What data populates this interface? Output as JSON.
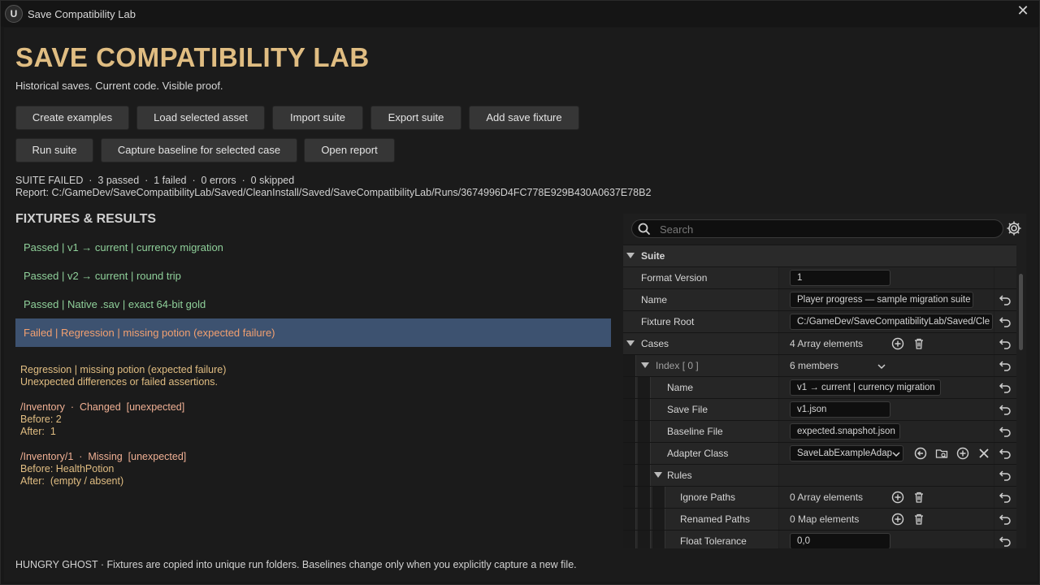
{
  "window": {
    "title": "Save Compatibility Lab",
    "close": "✕"
  },
  "header": {
    "title": "SAVE COMPATIBILITY LAB",
    "subtitle": "Historical saves. Current code. Visible proof."
  },
  "toolbar": {
    "create_examples": "Create examples",
    "load_selected_asset": "Load selected asset",
    "import_suite": "Import suite",
    "export_suite": "Export suite",
    "add_save_fixture": "Add save fixture",
    "run_suite": "Run suite",
    "capture_baseline": "Capture baseline for selected case",
    "open_report": "Open report"
  },
  "status": {
    "summary": "SUITE FAILED  ·  3 passed  ·  1 failed  ·  0 errors  ·  0 skipped",
    "report": "Report: C:/GameDev/SaveCompatibilityLab/Saved/CleanInstall/Saved/SaveCompatibilityLab/Runs/3674996D4FC778E929B430A0637E78B2"
  },
  "results": {
    "title": "FIXTURES & RESULTS",
    "rows": [
      {
        "text": "Passed  |  v1 → current | currency migration",
        "status": "passed"
      },
      {
        "text": "Passed  |  v2 → current | round trip",
        "status": "passed"
      },
      {
        "text": "Passed  |  Native .sav | exact 64-bit gold",
        "status": "passed"
      },
      {
        "text": "Failed  |  Regression | missing potion (expected failure)",
        "status": "failed"
      }
    ]
  },
  "detail": {
    "heading": "Regression | missing potion (expected failure)",
    "summary": "Unexpected differences or failed assertions.",
    "diffs": [
      {
        "header": "/Inventory  ·  Changed  [unexpected]",
        "before": "Before: 2",
        "after": "After:  1"
      },
      {
        "header": "/Inventory/1  ·  Missing  [unexpected]",
        "before": "Before: HealthPotion",
        "after": "After:  (empty / absent)"
      }
    ]
  },
  "footer": "HUNGRY GHOST  ·  Fixtures are copied into unique run folders. Baselines change only when you explicitly capture a new file.",
  "details_panel": {
    "search_placeholder": "Search",
    "suite": "Suite",
    "format_version_label": "Format Version",
    "format_version": "1",
    "name_label": "Name",
    "name": "Player progress — sample migration suite",
    "fixture_root_label": "Fixture Root",
    "fixture_root": "C:/GameDev/SaveCompatibilityLab/Saved/Cle",
    "cases_label": "Cases",
    "cases_value": "4 Array elements",
    "index_label": "Index [ 0 ]",
    "index_value": "6 members",
    "case_name_label": "Name",
    "case_name": "v1 → current | currency migration",
    "save_file_label": "Save File",
    "save_file": "v1.json",
    "baseline_file_label": "Baseline File",
    "baseline_file": "expected.snapshot.json",
    "adapter_class_label": "Adapter Class",
    "adapter_class": "SaveLabExampleAdap",
    "rules_label": "Rules",
    "ignore_paths_label": "Ignore Paths",
    "ignore_paths": "0 Array elements",
    "renamed_paths_label": "Renamed Paths",
    "renamed_paths": "0 Map elements",
    "float_tolerance_label": "Float Tolerance",
    "float_tolerance": "0,0"
  },
  "colors": {
    "accent": "#e0bd82",
    "pass": "#8fd09a",
    "fail": "#f2a070",
    "selected": "#3d5270"
  }
}
